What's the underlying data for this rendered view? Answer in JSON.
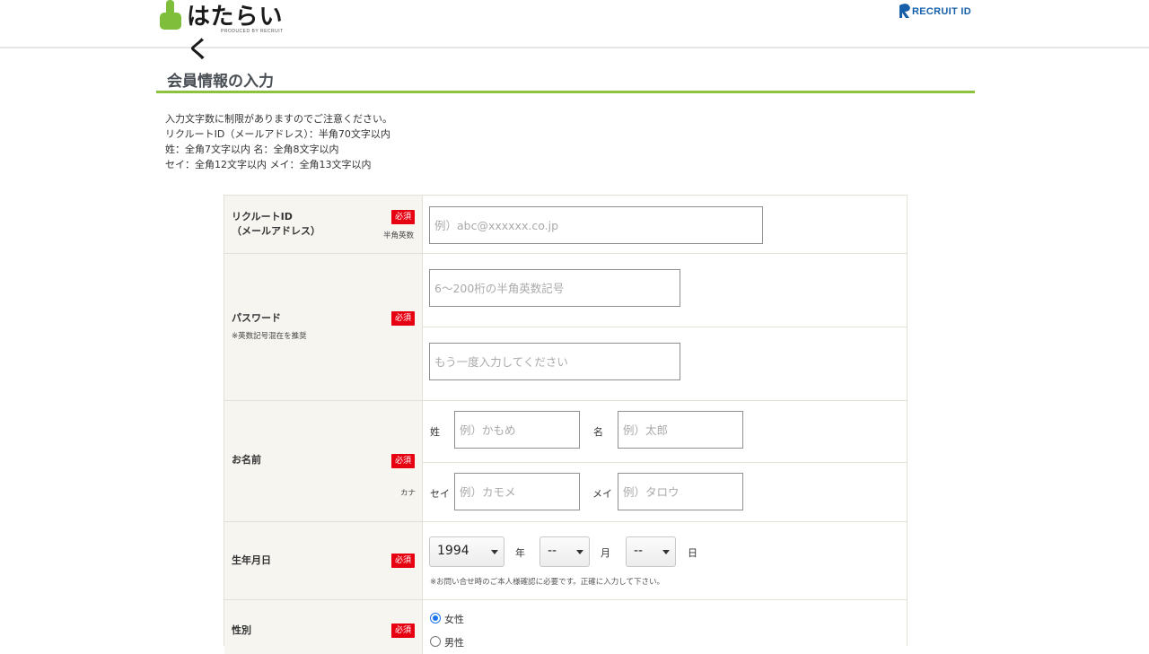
{
  "header": {
    "logo_text": "はたらいく",
    "logo_sub": "PRODUCED BY RECRUIT",
    "recruit_id": "RECRUIT ID"
  },
  "page": {
    "title": "会員情報の入力",
    "notes": [
      "入力文字数に制限がありますのでご注意ください。",
      "リクルートID（メールアドレス）：半角70文字以内",
      "姓：全角7文字以内 名：全角8文字以内",
      "セイ：全角12文字以内 メイ：全角13文字以内"
    ]
  },
  "form": {
    "required_badge": "必須",
    "recruit_id": {
      "label_line1": "リクルートID",
      "label_line2": "（メールアドレス）",
      "note": "半角英数",
      "placeholder": "例）abc@xxxxxx.co.jp"
    },
    "password": {
      "label": "パスワード",
      "sub": "※英数記号混在を推奨",
      "placeholder": "6〜200桁の半角英数記号",
      "confirm_placeholder": "もう一度入力してください"
    },
    "name": {
      "label": "お名前",
      "kana_note": "カナ",
      "sei_label": "姓",
      "sei_placeholder": "例）かもめ",
      "mei_label": "名",
      "mei_placeholder": "例）太郎",
      "sei_kana_label": "セイ",
      "sei_kana_placeholder": "例）カモメ",
      "mei_kana_label": "メイ",
      "mei_kana_placeholder": "例）タロウ"
    },
    "birthday": {
      "label": "生年月日",
      "year_value": "1994",
      "year_unit": "年",
      "month_value": "--",
      "month_unit": "月",
      "day_value": "--",
      "day_unit": "日",
      "hint": "※お問い合せ時のご本人様確認に必要です。正確に入力して下さい。"
    },
    "gender": {
      "label": "性別",
      "options": [
        "女性",
        "男性"
      ],
      "selected": "女性"
    }
  },
  "colors": {
    "accent_green": "#8dc33c",
    "required_red": "#e60012",
    "recruit_blue": "#1560a8"
  }
}
